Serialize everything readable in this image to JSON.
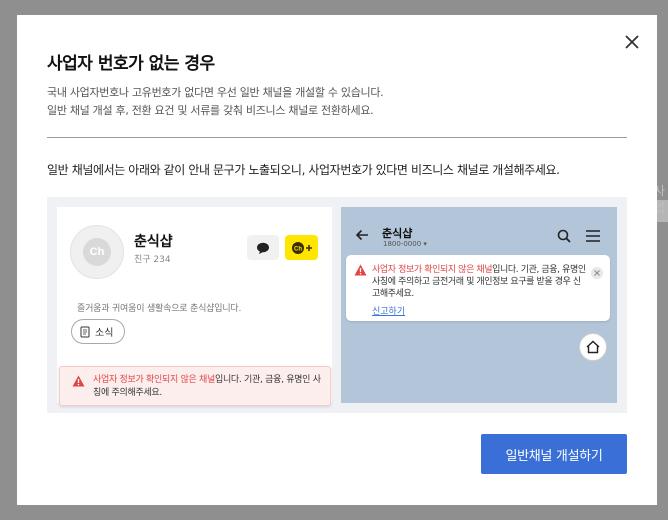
{
  "backdrop": {
    "peek_text": "사업"
  },
  "modal": {
    "title": "사업자 번호가 없는 경우",
    "description_line1": "국내 사업자번호나 고유번호가 없다면 우선 일반 채널을 개설할 수 있습니다.",
    "description_line2": "일반 채널 개설 후, 전환 요건 및 서류를 갖춰 비즈니스 채널로 전환하세요.",
    "notice": "일반 채널에서는 아래와 같이 안내 문구가 노출되오니, 사업자번호가 있다면 비즈니스 채널로 개설해주세요.",
    "cta_label": "일반채널 개설하기"
  },
  "profile_card": {
    "avatar_text": "Ch",
    "channel_name": "춘식샵",
    "friends": "친구 234",
    "intro": "즐거움과 귀여움이 생활속으로 춘식샵입니다.",
    "news_label": "소식",
    "warning_highlight": "사업자 정보가 확인되지 않은 채널",
    "warning_rest": "입니다. 기관, 금융, 유명인 사칭에 주의해주세요."
  },
  "chatroom": {
    "channel_name": "춘식샵",
    "phone": "1800-0000 ▾",
    "warning_highlight": "사업자 정보가 확인되지 않은 채널",
    "warning_rest": "입니다. 기관, 금융, 유명인 사칭에 주의하고 금전거래 및 개인정보 요구를 받을 경우 신고해주세요.",
    "report_link": "신고하기"
  },
  "colors": {
    "accent": "#3b6fd8",
    "warning_red": "#e04545",
    "kakao_yellow": "#ffe500",
    "chatroom_bg": "#b3c5d8"
  },
  "icons": [
    "close-icon",
    "chat-bubble-icon",
    "channel-add-icon",
    "document-icon",
    "warning-icon",
    "back-arrow-icon",
    "search-icon",
    "menu-icon",
    "home-icon"
  ]
}
